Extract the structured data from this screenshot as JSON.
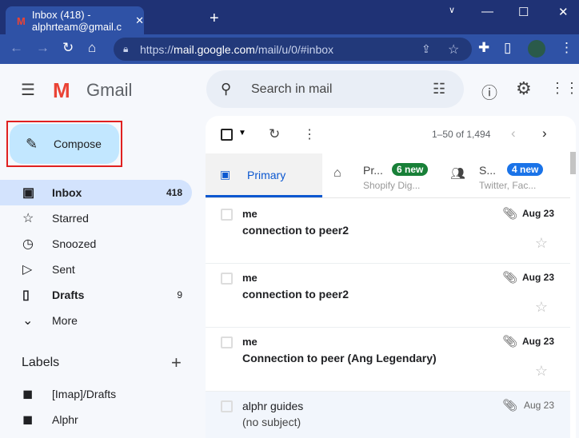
{
  "browser": {
    "tab_title": "Inbox (418) - alphrteam@gmail.c",
    "url_scheme": "https://",
    "url_host": "mail.google.com",
    "url_path": "/mail/u/0/#inbox"
  },
  "app": {
    "name": "Gmail",
    "search_placeholder": "Search in mail"
  },
  "compose_label": "Compose",
  "nav": [
    {
      "label": "Inbox",
      "count": "418",
      "icon": "inbox-icon"
    },
    {
      "label": "Starred",
      "icon": "star-icon"
    },
    {
      "label": "Snoozed",
      "icon": "clock-icon"
    },
    {
      "label": "Sent",
      "icon": "send-icon"
    },
    {
      "label": "Drafts",
      "count": "9",
      "icon": "draft-icon"
    },
    {
      "label": "More",
      "icon": "chevron-down-icon"
    }
  ],
  "labels": {
    "title": "Labels",
    "items": [
      "[Imap]/Drafts",
      "Alphr"
    ]
  },
  "toolbar": {
    "pagination": "1–50 of 1,494"
  },
  "tabs": [
    {
      "label": "Primary"
    },
    {
      "label": "Pr...",
      "badge": "6 new",
      "sub": "Shopify Dig...",
      "color": "#188038"
    },
    {
      "label": "S...",
      "badge": "4 new",
      "sub": "Twitter, Fac...",
      "color": "#1a73e8"
    }
  ],
  "emails": [
    {
      "from": "me",
      "subject": "connection to peer2",
      "date": "Aug 23"
    },
    {
      "from": "me",
      "subject": "connection to peer2",
      "date": "Aug 23"
    },
    {
      "from": "me",
      "subject": "Connection to peer (Ang Legendary)",
      "date": "Aug 23"
    },
    {
      "from": "alphr guides",
      "subject": "(no subject)",
      "date": "Aug 23"
    }
  ]
}
